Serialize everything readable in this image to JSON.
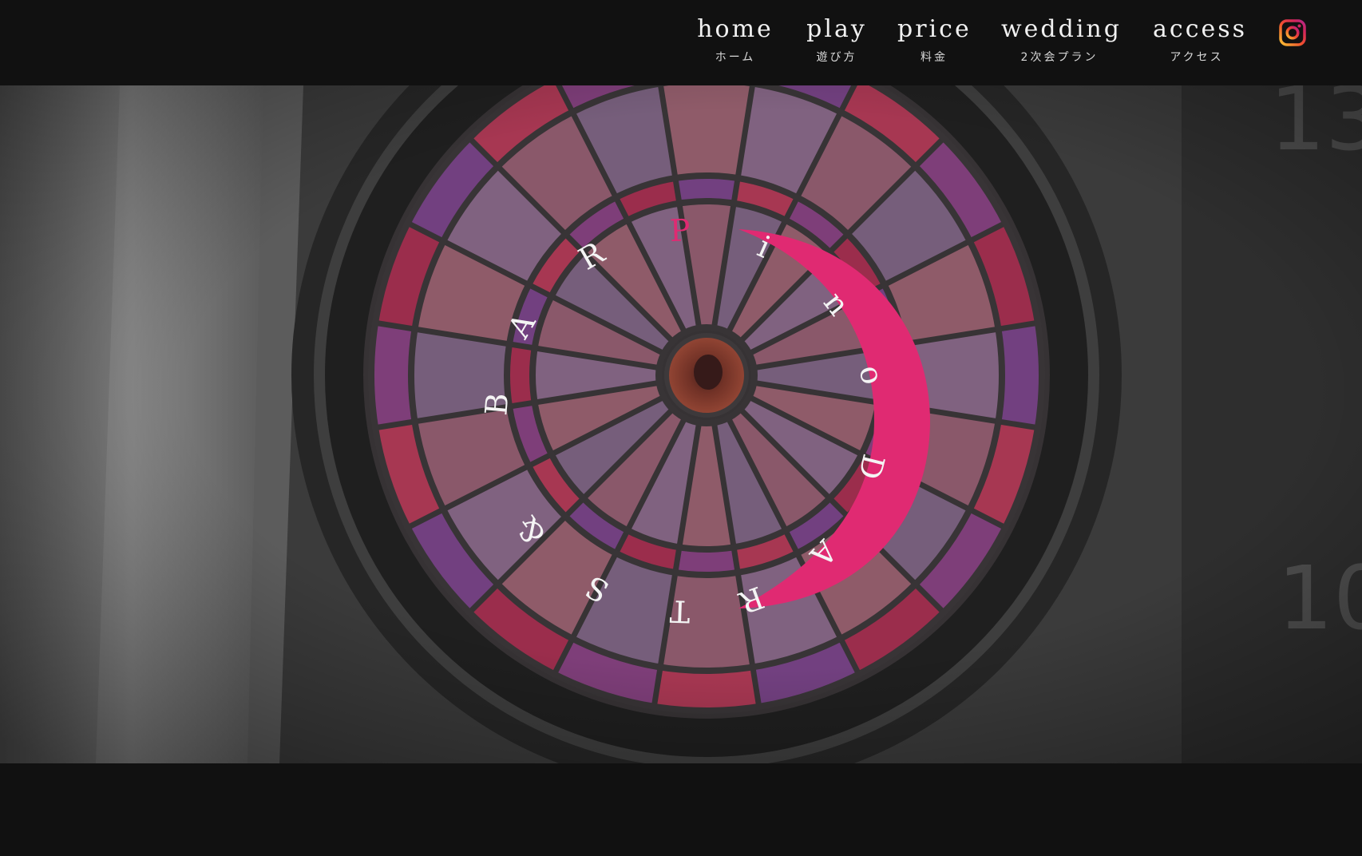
{
  "nav": {
    "items": [
      {
        "en": "home",
        "jp": "ホーム"
      },
      {
        "en": "play",
        "jp": "遊び方"
      },
      {
        "en": "price",
        "jp": "料金"
      },
      {
        "en": "wedding",
        "jp": "2次会プラン"
      },
      {
        "en": "access",
        "jp": "アクセス"
      }
    ],
    "social_icon": "instagram-icon"
  },
  "hero": {
    "logo_letters": [
      "B",
      "A",
      "R",
      "P",
      "i",
      "n",
      "o",
      "D",
      "A",
      "R",
      "T",
      "S",
      "&"
    ],
    "colors": {
      "accent": "#e02a72",
      "logo_text": "#f4f4f4",
      "page_bg": "#111111"
    }
  }
}
